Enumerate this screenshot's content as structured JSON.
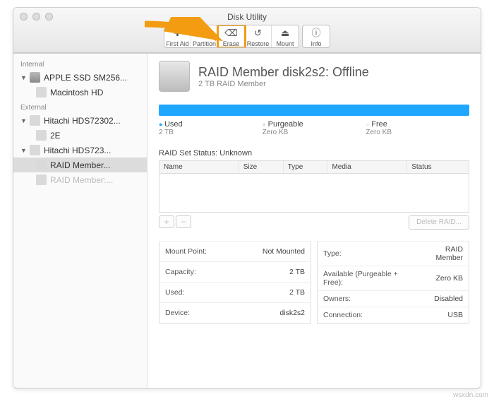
{
  "window": {
    "title": "Disk Utility"
  },
  "toolbar": {
    "first_aid": "First Aid",
    "partition": "Partition",
    "erase": "Erase",
    "restore": "Restore",
    "mount": "Mount",
    "info": "Info"
  },
  "sidebar": {
    "internal_head": "Internal",
    "external_head": "External",
    "internal": [
      {
        "label": "APPLE SSD SM256..."
      },
      {
        "label": "Macintosh HD"
      }
    ],
    "external": [
      {
        "label": "Hitachi HDS72302..."
      },
      {
        "label": "2E"
      },
      {
        "label": "Hitachi HDS723..."
      },
      {
        "label": "RAID Member..."
      },
      {
        "label": "RAID Member:..."
      }
    ]
  },
  "main": {
    "title": "RAID Member disk2s2: Offline",
    "subtitle": "2 TB RAID Member",
    "legend": {
      "used_label": "Used",
      "used_val": "2 TB",
      "purge_label": "Purgeable",
      "purge_val": "Zero KB",
      "free_label": "Free",
      "free_val": "Zero KB"
    },
    "raid_status_label": "RAID Set Status: Unknown",
    "columns": {
      "name": "Name",
      "size": "Size",
      "type": "Type",
      "media": "Media",
      "status": "Status"
    },
    "delete_label": "Delete RAID...",
    "info_left": [
      [
        "Mount Point:",
        "Not Mounted"
      ],
      [
        "Capacity:",
        "2 TB"
      ],
      [
        "Used:",
        "2 TB"
      ],
      [
        "Device:",
        "disk2s2"
      ]
    ],
    "info_right": [
      [
        "Type:",
        "RAID Member"
      ],
      [
        "Available (Purgeable + Free):",
        "Zero KB"
      ],
      [
        "Owners:",
        "Disabled"
      ],
      [
        "Connection:",
        "USB"
      ]
    ]
  },
  "watermark": "wsxdn.com"
}
